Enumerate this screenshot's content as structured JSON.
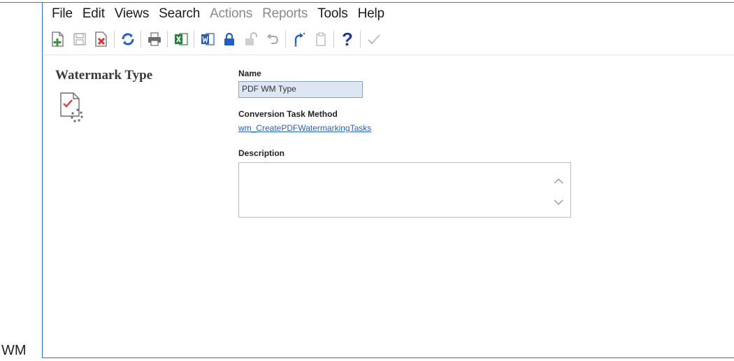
{
  "menu": {
    "items": [
      {
        "label": "File",
        "enabled": true
      },
      {
        "label": "Edit",
        "enabled": true
      },
      {
        "label": "Views",
        "enabled": true
      },
      {
        "label": "Search",
        "enabled": true
      },
      {
        "label": "Actions",
        "enabled": false
      },
      {
        "label": "Reports",
        "enabled": false
      },
      {
        "label": "Tools",
        "enabled": true
      },
      {
        "label": "Help",
        "enabled": true
      }
    ]
  },
  "toolbar": {
    "icons": [
      "new-record-icon",
      "save-icon",
      "delete-icon",
      "refresh-icon",
      "print-icon",
      "excel-export-icon",
      "word-export-icon",
      "lock-icon",
      "unlock-icon",
      "undo-icon",
      "redo-icon",
      "clipboard-icon",
      "help-icon",
      "checkmark-icon"
    ]
  },
  "page": {
    "title": "Watermark Type",
    "icon": "watermark-type-icon"
  },
  "form": {
    "name_label": "Name",
    "name_value": "PDF WM Type",
    "method_label": "Conversion Task Method",
    "method_value": "wm_CreatePDFWatermarkingTasks",
    "description_label": "Description",
    "description_value": ""
  },
  "outside_label": "WM",
  "colors": {
    "window_border": "#2b6cc4",
    "input_fill": "#dde6f2",
    "link": "#2a5fb5",
    "green": "#2e9a3c",
    "red": "#d9342b",
    "blue": "#1e5fbf"
  }
}
